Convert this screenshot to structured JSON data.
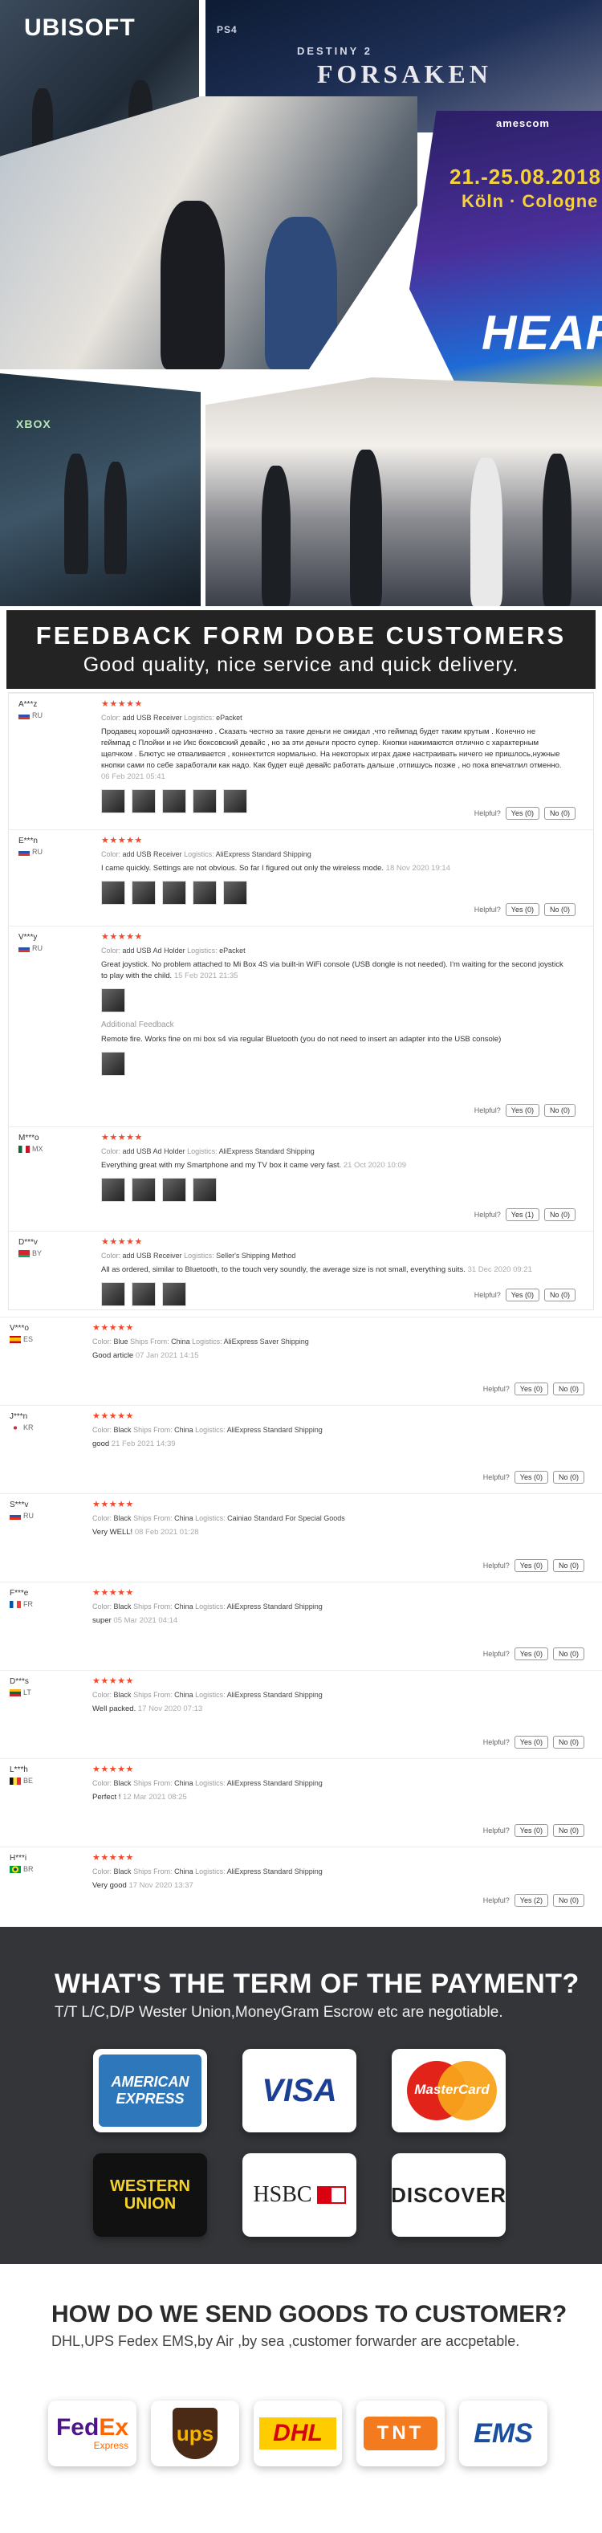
{
  "collage": {
    "ubisoft": "UBISOFT",
    "destiny": "DESTINY 2",
    "forsaken": "FORSAKEN",
    "ps4": "PS4",
    "site": "amescom",
    "date": "21.-25.08.2018",
    "city": "Köln · Cologne",
    "heart": "HEART",
    "xbox": "XBOX"
  },
  "feedback_header": {
    "title": "FEEDBACK FORM DOBE CUSTOMERS",
    "subtitle": "Good quality, nice service and quick delivery."
  },
  "helpful_label": "Helpful?",
  "reviews_boxed": [
    {
      "user": "A***z",
      "country": "RU",
      "flag": "ru",
      "color": "Color:",
      "color_val": "add USB Receiver",
      "logistics": "Logistics:",
      "logistics_val": "ePacket",
      "text": "Продавец хороший однозначно . Сказать честно за такие деньги не ожидал ,что геймпад будет таким крутым . Конечно не геймпад с Плойки и не Икс боксовский девайс , но за эти деньги просто супер. Кнопки нажимаются отлично с характерным щелчком . Блютус не отваливается , коннектится нормально. На некоторых играх даже настраивать ничего не пришлось,нужные кнопки сами по себе заработали как надо. Как будет ещё девайс работать дальше ,отпишусь позже , но пока впечатлил отменно.",
      "date": "06 Feb 2021 05:41",
      "thumbs": 5,
      "yes": "Yes (0)",
      "no": "No (0)"
    },
    {
      "user": "E***n",
      "country": "RU",
      "flag": "ru",
      "color": "Color:",
      "color_val": "add USB Receiver",
      "logistics": "Logistics:",
      "logistics_val": "AliExpress Standard Shipping",
      "text": "I came quickly. Settings are not obvious. So far I figured out only the wireless mode.",
      "date": "18 Nov 2020 19:14",
      "thumbs": 5,
      "yes": "Yes (0)",
      "no": "No (0)"
    },
    {
      "user": "V***y",
      "country": "RU",
      "flag": "ru",
      "color": "Color:",
      "color_val": "add USB Ad Holder",
      "logistics": "Logistics:",
      "logistics_val": "ePacket",
      "text": "Great joystick. No problem attached to Mi Box 4S via built-in WiFi console (USB dongle is not needed). I'm waiting for the second joystick to play with the child.",
      "date": "15 Feb 2021 21:35",
      "thumbs": 1,
      "additional_label": "Additional Feedback",
      "additional": "Remote fire. Works fine on mi box s4 via regular Bluetooth (you do not need to insert an adapter into the USB console)",
      "yes": "Yes (0)",
      "no": "No (0)"
    },
    {
      "user": "M***o",
      "country": "MX",
      "flag": "mx",
      "color": "Color:",
      "color_val": "add USB Ad Holder",
      "logistics": "Logistics:",
      "logistics_val": "AliExpress Standard Shipping",
      "text": "Everything great with my Smartphone and my TV box it came very fast.",
      "date": "21 Oct 2020 10:09",
      "thumbs": 4,
      "yes": "Yes (1)",
      "no": "No (0)"
    },
    {
      "user": "D***v",
      "country": "BY",
      "flag": "by",
      "color": "Color:",
      "color_val": "add USB Receiver",
      "logistics": "Logistics:",
      "logistics_val": "Seller's Shipping Method",
      "text": "All as ordered, similar to Bluetooth, to the touch very soundly, the average size is not small, everything suits.",
      "date": "31 Dec 2020 09:21",
      "thumbs": 3,
      "yes": "Yes (0)",
      "no": "No (0)"
    }
  ],
  "reviews_plain": [
    {
      "user": "V***o",
      "country": "ES",
      "flag": "es",
      "color": "Color:",
      "color_val": "Blue",
      "ships": "Ships From:",
      "ships_val": "China",
      "logistics": "Logistics:",
      "logistics_val": "AliExpress Saver Shipping",
      "text": "Good article",
      "date": "07 Jan 2021 14:15",
      "yes": "Yes (0)",
      "no": "No (0)"
    },
    {
      "user": "J***n",
      "country": "KR",
      "flag": "kr",
      "color": "Color:",
      "color_val": "Black",
      "ships": "Ships From:",
      "ships_val": "China",
      "logistics": "Logistics:",
      "logistics_val": "AliExpress Standard Shipping",
      "text": "good",
      "date": "21 Feb 2021 14:39",
      "yes": "Yes (0)",
      "no": "No (0)"
    },
    {
      "user": "S***v",
      "country": "RU",
      "flag": "ru",
      "color": "Color:",
      "color_val": "Black",
      "ships": "Ships From:",
      "ships_val": "China",
      "logistics": "Logistics:",
      "logistics_val": "Cainiao Standard For Special Goods",
      "text": "Very WELL!",
      "date": "08 Feb 2021 01:28",
      "yes": "Yes (0)",
      "no": "No (0)"
    },
    {
      "user": "F***e",
      "country": "FR",
      "flag": "fr",
      "color": "Color:",
      "color_val": "Black",
      "ships": "Ships From:",
      "ships_val": "China",
      "logistics": "Logistics:",
      "logistics_val": "AliExpress Standard Shipping",
      "text": "super",
      "date": "05 Mar 2021 04:14",
      "yes": "Yes (0)",
      "no": "No (0)"
    },
    {
      "user": "D***s",
      "country": "LT",
      "flag": "lt",
      "color": "Color:",
      "color_val": "Black",
      "ships": "Ships From:",
      "ships_val": "China",
      "logistics": "Logistics:",
      "logistics_val": "AliExpress Standard Shipping",
      "text": "Well packed.",
      "date": "17 Nov 2020 07:13",
      "yes": "Yes (0)",
      "no": "No (0)"
    },
    {
      "user": "L***h",
      "country": "BE",
      "flag": "be",
      "color": "Color:",
      "color_val": "Black",
      "ships": "Ships From:",
      "ships_val": "China",
      "logistics": "Logistics:",
      "logistics_val": "AliExpress Standard Shipping",
      "text": "Perfect !",
      "date": "12 Mar 2021 08:25",
      "yes": "Yes (0)",
      "no": "No (0)"
    },
    {
      "user": "H***i",
      "country": "BR",
      "flag": "br",
      "color": "Color:",
      "color_val": "Black",
      "ships": "Ships From:",
      "ships_val": "China",
      "logistics": "Logistics:",
      "logistics_val": "AliExpress Standard Shipping",
      "text": "Very good",
      "date": "17 Nov 2020 13:37",
      "yes": "Yes (2)",
      "no": "No (0)"
    }
  ],
  "payment": {
    "title": "WHAT'S THE TERM OF THE PAYMENT?",
    "subtitle": "T/T L/C,D/P Wester Union,MoneyGram Escrow etc are negotiable.",
    "amex_1": "AMERICAN",
    "amex_2": "EXPRESS",
    "visa": "VISA",
    "mastercard": "MasterCard",
    "western_1": "WESTERN",
    "western_2": "UNION",
    "hsbc": "HSBC",
    "discover": "DISCOVER"
  },
  "shipping": {
    "title": "HOW DO WE SEND GOODS TO CUSTOMER?",
    "subtitle": "DHL,UPS Fedex EMS,by Air ,by sea ,customer forwarder are accpetable.",
    "fedex_1": "Fed",
    "fedex_2": "Ex",
    "fedex_3": "Express",
    "ups": "ups",
    "dhl": "DHL",
    "tnt": "TNT",
    "ems": "EMS"
  },
  "colors": {
    "star": "#f2492a",
    "dark_band": "#333538",
    "header_band": "#232323"
  }
}
